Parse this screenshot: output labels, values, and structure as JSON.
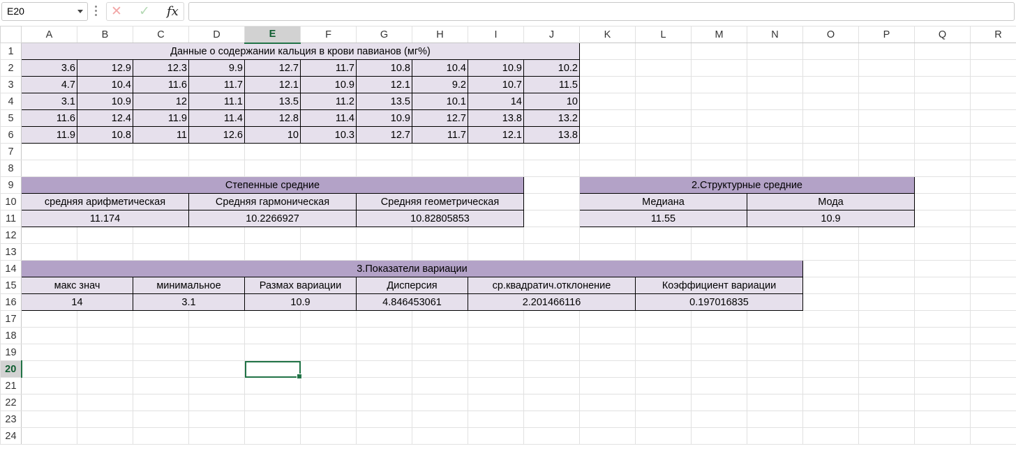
{
  "name_box": "E20",
  "formula_bar": {
    "cancel_icon": "✕",
    "enter_icon": "✓",
    "fx_label": "fx",
    "content": ""
  },
  "columns": [
    "A",
    "B",
    "C",
    "D",
    "E",
    "F",
    "G",
    "H",
    "I",
    "J",
    "K",
    "L",
    "M",
    "N",
    "O",
    "P",
    "Q",
    "R"
  ],
  "rows": [
    "1",
    "2",
    "3",
    "4",
    "5",
    "6",
    "7",
    "8",
    "9",
    "10",
    "11",
    "12",
    "13",
    "14",
    "15",
    "16",
    "17",
    "18",
    "19",
    "20",
    "21",
    "22",
    "23",
    "24"
  ],
  "selected_cell": {
    "column": "E",
    "row": "20"
  },
  "calcium_table": {
    "title": "Данные о содержании кальция в крови павианов (мг%)",
    "rows": [
      [
        "3.6",
        "12.9",
        "12.3",
        "9.9",
        "12.7",
        "11.7",
        "10.8",
        "10.4",
        "10.9",
        "10.2"
      ],
      [
        "4.7",
        "10.4",
        "11.6",
        "11.7",
        "12.1",
        "10.9",
        "12.1",
        "9.2",
        "10.7",
        "11.5"
      ],
      [
        "3.1",
        "10.9",
        "12",
        "11.1",
        "13.5",
        "11.2",
        "13.5",
        "10.1",
        "14",
        "10"
      ],
      [
        "11.6",
        "12.4",
        "11.9",
        "11.4",
        "12.8",
        "11.4",
        "10.9",
        "12.7",
        "13.8",
        "13.2"
      ],
      [
        "11.9",
        "10.8",
        "11",
        "12.6",
        "10",
        "10.3",
        "12.7",
        "11.7",
        "12.1",
        "13.8"
      ]
    ]
  },
  "power_means": {
    "title": "Степенные средние",
    "headers": [
      "средняя арифметическая",
      "Средняя гармоническая",
      "Средняя геометрическая"
    ],
    "values": [
      "11.174",
      "10.2266927",
      "10.82805853"
    ]
  },
  "structural_means": {
    "title": "2.Структурные средние",
    "headers": [
      "Медиана",
      "Мода"
    ],
    "values": [
      "11.55",
      "10.9"
    ]
  },
  "variation": {
    "title": "3.Показатели вариации",
    "headers": [
      "макс знач",
      "минимальное",
      "Размах вариации",
      "Дисперсия",
      "ср.квадратич.отклонение",
      "Коэффициент вариации"
    ],
    "values": [
      "14",
      "3.1",
      "10.9",
      "4.846453061",
      "2.201466116",
      "0.197016835"
    ]
  }
}
